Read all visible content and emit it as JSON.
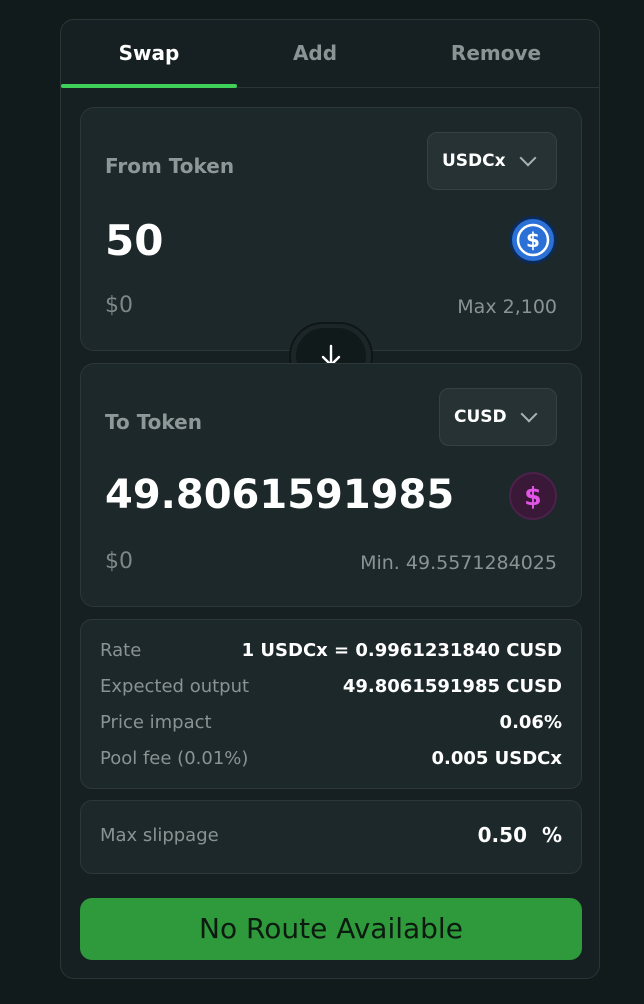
{
  "tabs": [
    {
      "label": "Swap",
      "active": true
    },
    {
      "label": "Add",
      "active": false
    },
    {
      "label": "Remove",
      "active": false
    }
  ],
  "from": {
    "label": "From Token",
    "token": "USDCx",
    "amount": "50",
    "usd": "$0",
    "balance": "Max 2,100",
    "icon": "usdc-coin-icon",
    "icon_color": "#2a70d6"
  },
  "to": {
    "label": "To Token",
    "token": "CUSD",
    "amount": "49.8061591985",
    "usd": "$0",
    "min_received": "Min. 49.5571284025",
    "icon": "dollar-coin-icon",
    "icon_color": "#e255e6"
  },
  "details": [
    {
      "label": "Rate",
      "value": "1 USDCx = 0.9961231840 CUSD"
    },
    {
      "label": "Expected output",
      "value": "49.8061591985 CUSD"
    },
    {
      "label": "Price impact",
      "value": "0.06%"
    },
    {
      "label": "Pool fee (0.01%)",
      "value": "0.005 USDCx"
    }
  ],
  "slippage": {
    "label": "Max slippage",
    "value": "0.50",
    "unit": "%"
  },
  "cta_label": "No Route Available",
  "colors": {
    "accent": "#3fd05a",
    "cta_bg": "#2e9a3b",
    "background": "#121b1c"
  }
}
